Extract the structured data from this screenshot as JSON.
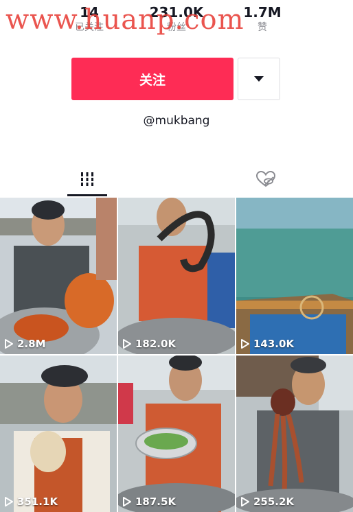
{
  "watermark": "www.huanp.com",
  "profile": {
    "following_count": "14",
    "following_label": "已关注",
    "followers_count": "231.0K",
    "followers_label": "粉丝",
    "likes_count": "1.7M",
    "likes_label": "赞",
    "follow_label": "关注",
    "username": "@mukbang"
  },
  "icons": {
    "more": "caret-down-icon",
    "works_tab": "grid-bars-icon",
    "liked_tab": "hidden-heart-icon",
    "play": "play-outline-icon"
  },
  "colors": {
    "accent": "#fe2c55",
    "watermark": "#e8433d",
    "text": "#161823",
    "muted": "#8a8b91"
  },
  "videos": [
    {
      "plays": "2.8M"
    },
    {
      "plays": "182.0K"
    },
    {
      "plays": "143.0K"
    },
    {
      "plays": "351.1K"
    },
    {
      "plays": "187.5K"
    },
    {
      "plays": "255.2K"
    }
  ]
}
